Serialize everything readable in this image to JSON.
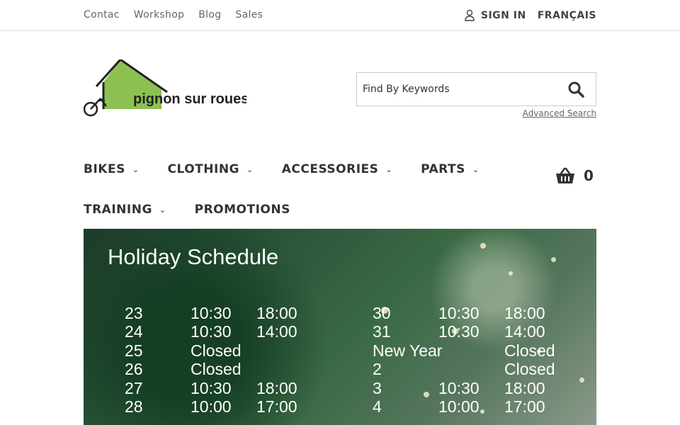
{
  "topbar": {
    "links": [
      "Contac",
      "Workshop",
      "Blog",
      "Sales"
    ],
    "sign_in": "SIGN IN",
    "language": "FRANÇAIS"
  },
  "search": {
    "placeholder": "Find By Keywords",
    "advanced": "Advanced Search"
  },
  "logo": {
    "text": "pignon sur roues"
  },
  "nav": {
    "row1": [
      {
        "label": "BIKES",
        "has_menu": true
      },
      {
        "label": "CLOTHING",
        "has_menu": true
      },
      {
        "label": "ACCESSORIES",
        "has_menu": true
      },
      {
        "label": "PARTS",
        "has_menu": true
      }
    ],
    "row2": [
      {
        "label": "TRAINING",
        "has_menu": true
      },
      {
        "label": "PROMOTIONS",
        "has_menu": false
      }
    ]
  },
  "cart": {
    "count": "0"
  },
  "banner": {
    "title": "Holiday Schedule",
    "left": [
      [
        "23",
        "10:30",
        "18:00"
      ],
      [
        "24",
        "10:30",
        "14:00"
      ],
      [
        "25",
        "Closed",
        ""
      ],
      [
        "26",
        "Closed",
        ""
      ],
      [
        "27",
        "10:30",
        "18:00"
      ],
      [
        "28",
        "10:00",
        "17:00"
      ]
    ],
    "right": [
      [
        "30",
        "10:30",
        "18:00"
      ],
      [
        "31",
        "10:30",
        "14:00"
      ],
      [
        "New Year",
        "",
        "Closed"
      ],
      [
        "2",
        "",
        "Closed"
      ],
      [
        "3",
        "10:30",
        "18:00"
      ],
      [
        "4",
        "10:00",
        "17:00"
      ]
    ]
  },
  "colors": {
    "logo_green": "#8cc152",
    "text_dark": "#333333"
  }
}
